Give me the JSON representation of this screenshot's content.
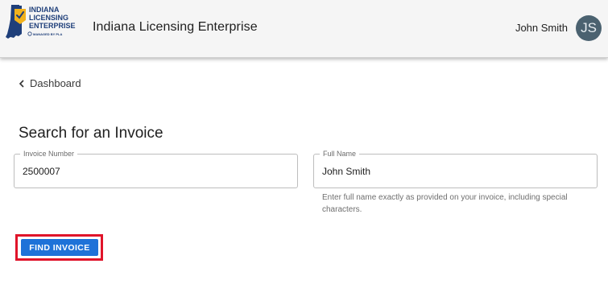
{
  "header": {
    "logo": {
      "line1": "INDIANA",
      "line2": "LICENSING",
      "line3": "ENTERPRISE",
      "tagline": "MANAGED BY PLA"
    },
    "app_title": "Indiana Licensing Enterprise",
    "user_name": "John Smith",
    "avatar_initials": "JS"
  },
  "nav": {
    "back_label": "Dashboard"
  },
  "page": {
    "title": "Search for an Invoice"
  },
  "form": {
    "invoice_number": {
      "label": "Invoice Number",
      "value": "2500007"
    },
    "full_name": {
      "label": "Full Name",
      "value": "John Smith",
      "hint": "Enter full name exactly as provided on your invoice, including special characters."
    },
    "submit_label": "FIND INVOICE"
  },
  "colors": {
    "accent": "#1e72d8",
    "focus_ring": "#e0142a",
    "avatar": "#4b6270",
    "logo_blue": "#1f3f7a",
    "logo_gold": "#f2b21c"
  }
}
